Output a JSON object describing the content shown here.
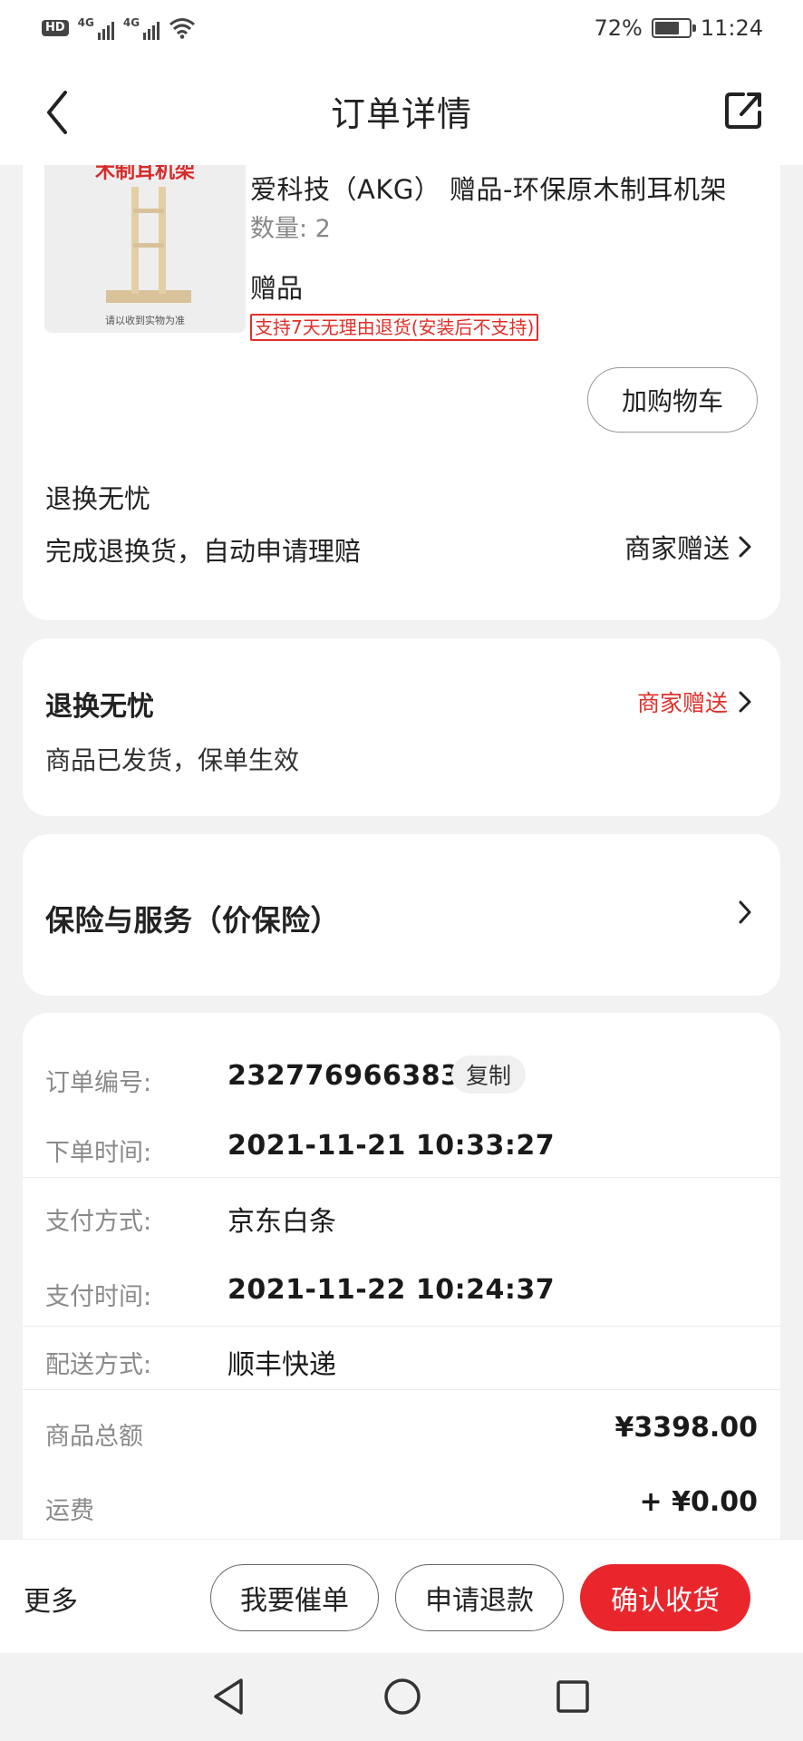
{
  "status_bar": {
    "hd_badge": "HD",
    "sim1": "4G",
    "sim2": "4G",
    "battery_text": "72%",
    "battery_level": 0.72,
    "time": "11:24"
  },
  "header": {
    "title": "订单详情",
    "back_icon": "chevron-left-icon",
    "share_icon": "share-icon"
  },
  "product": {
    "image_top_text": "木制耳机架",
    "image_bottom_text": "请以收到实物为准",
    "title": "爱科技（AKG） 赠品-环保原木制耳机架",
    "quantity": "数量: 2",
    "gift_label": "赠品",
    "return_tag": "支持7天无理由退货(安装后不支持)",
    "add_cart_label": "加购物车"
  },
  "worry_free_inline": {
    "label": "退换无忧",
    "description": "完成退换货，自动申请理赔",
    "link_text": "商家赠送"
  },
  "worry_free_card": {
    "title": "退换无忧",
    "link_text": "商家赠送",
    "description": "商品已发货，保单生效",
    "link_color": "#e0302a"
  },
  "insurance_card": {
    "title": "保险与服务（价保险）"
  },
  "order_info": {
    "order_no_label": "订单编号:",
    "order_no": "232776966383",
    "copy_label": "复制",
    "order_time_label": "下单时间:",
    "order_time": "2021-11-21 10:33:27",
    "pay_method_label": "支付方式:",
    "pay_method": "京东白条",
    "pay_time_label": "支付时间:",
    "pay_time": "2021-11-22 10:24:37",
    "delivery_label": "配送方式:",
    "delivery": "顺丰快递",
    "goods_total_label": "商品总额",
    "goods_total": "¥3398.00",
    "shipping_label": "运费",
    "shipping": "+ ¥0.00"
  },
  "action_bar": {
    "more_label": "更多",
    "urge_label": "我要催单",
    "refund_label": "申请退款",
    "confirm_label": "确认收货",
    "confirm_color": "#e8262c"
  },
  "system_nav": {
    "back_icon": "triangle-back-icon",
    "home_icon": "circle-home-icon",
    "recent_icon": "square-recent-icon"
  }
}
